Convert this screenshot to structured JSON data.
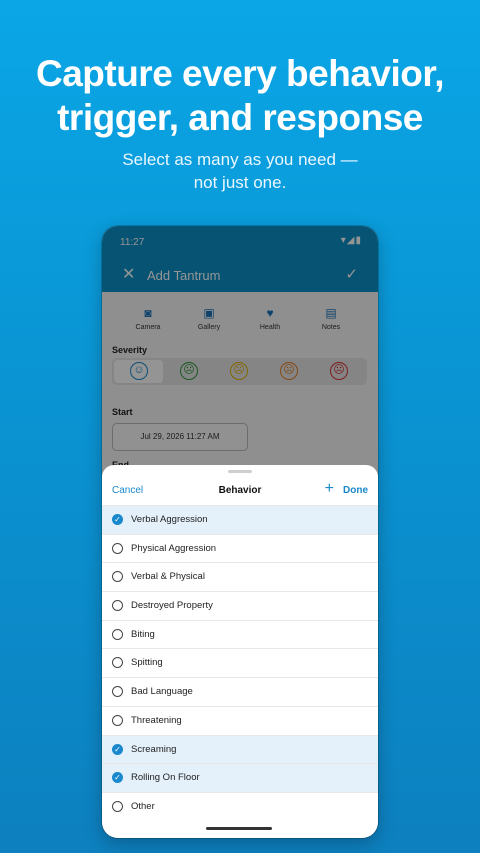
{
  "marketing": {
    "headline_line1": "Capture every behavior,",
    "headline_line2": "trigger, and response",
    "subline_line1": "Select as many as you need —",
    "subline_line2": "not just one."
  },
  "status": {
    "time": "11:27",
    "icons": "▾◢▮"
  },
  "appbar": {
    "title": "Add Tantrum",
    "close_icon": "✕",
    "save_icon": "✓"
  },
  "attachments": [
    {
      "label": "Camera",
      "icon": "camera-icon",
      "glyph": "◙"
    },
    {
      "label": "Gallery",
      "icon": "gallery-icon",
      "glyph": "▣"
    },
    {
      "label": "Health",
      "icon": "health-icon",
      "glyph": "♥"
    },
    {
      "label": "Notes",
      "icon": "notes-icon",
      "glyph": "▤"
    }
  ],
  "severity": {
    "label": "Severity",
    "selected_index": 0,
    "faces": [
      {
        "color": "#1a88cc",
        "glyph": "☺"
      },
      {
        "color": "#2e9a3a",
        "glyph": "☹"
      },
      {
        "color": "#e0b100",
        "glyph": "☹"
      },
      {
        "color": "#e67e22",
        "glyph": "☹"
      },
      {
        "color": "#d63031",
        "glyph": "☹"
      }
    ]
  },
  "start": {
    "label": "Start",
    "value": "Jul 29, 2026 11:27 AM"
  },
  "end": {
    "label": "End"
  },
  "sheet": {
    "cancel": "Cancel",
    "title": "Behavior",
    "add_icon": "+",
    "done": "Done",
    "items": [
      {
        "label": "Verbal Aggression",
        "selected": true
      },
      {
        "label": "Physical Aggression",
        "selected": false
      },
      {
        "label": "Verbal & Physical",
        "selected": false
      },
      {
        "label": "Destroyed Property",
        "selected": false
      },
      {
        "label": "Biting",
        "selected": false
      },
      {
        "label": "Spitting",
        "selected": false
      },
      {
        "label": "Bad Language",
        "selected": false
      },
      {
        "label": "Threatening",
        "selected": false
      },
      {
        "label": "Screaming",
        "selected": true
      },
      {
        "label": "Rolling On Floor",
        "selected": true
      },
      {
        "label": "Other",
        "selected": false
      }
    ]
  },
  "colors": {
    "accent": "#1a88cc",
    "appbar": "#0d90c8",
    "background": "#0a94d3"
  }
}
